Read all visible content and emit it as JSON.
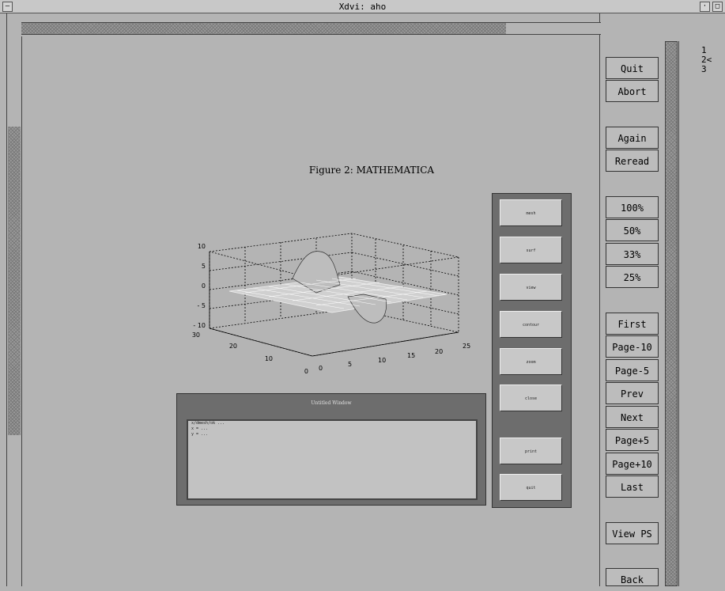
{
  "window": {
    "title": "Xdvi:  aho",
    "menu_glyph": "—",
    "min_glyph": "·",
    "max_glyph": "□"
  },
  "document": {
    "figure_caption": "Figure 2: MATHEMATICA"
  },
  "plot": {
    "z_ticks": [
      "10",
      "5",
      "0",
      "- 5",
      "- 10"
    ],
    "y_ticks": [
      "30",
      "20",
      "10",
      "0"
    ],
    "x_ticks": [
      "0",
      "5",
      "10",
      "15",
      "20",
      "25"
    ]
  },
  "figure_command_window": {
    "title": "Untitled Window",
    "lines": [
      "x/dmesh/ok ...",
      "x = ...",
      "y = ..."
    ]
  },
  "figure_buttons": [
    "mesh",
    "surf",
    "view",
    "contour",
    "zoom",
    "close",
    "print",
    "quit"
  ],
  "controls": {
    "quit": "Quit",
    "abort": "Abort",
    "again": "Again",
    "reread": "Reread",
    "zoom100": "100%",
    "zoom50": "50%",
    "zoom33": "33%",
    "zoom25": "25%",
    "first": "First",
    "page_minus10": "Page-10",
    "page_minus5": "Page-5",
    "prev": "Prev",
    "next": "Next",
    "page_plus5": "Page+5",
    "page_plus10": "Page+10",
    "last": "Last",
    "view_ps": "View PS",
    "back": "Back"
  },
  "page_list": [
    "1",
    "2<",
    "3"
  ]
}
